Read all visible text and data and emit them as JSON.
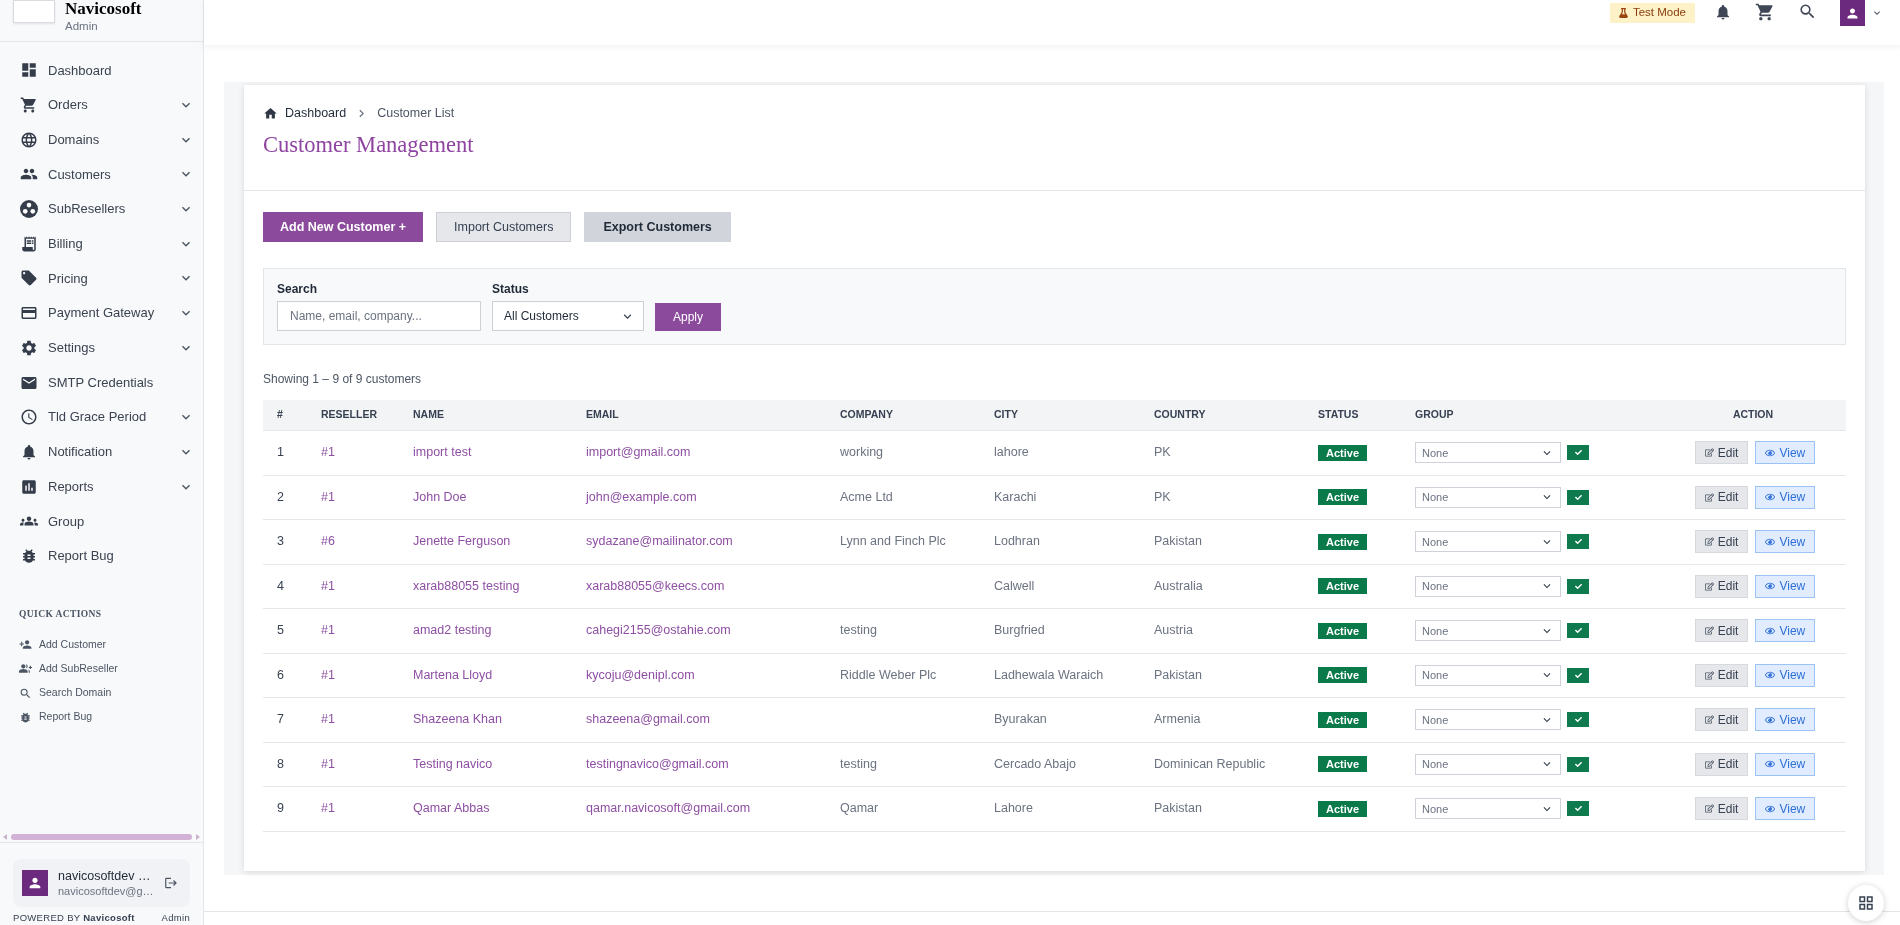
{
  "sidebar": {
    "brand": {
      "name": "Navicosoft",
      "role": "Admin"
    },
    "menu": [
      {
        "label": "Dashboard",
        "expandable": false
      },
      {
        "label": "Orders",
        "expandable": true
      },
      {
        "label": "Domains",
        "expandable": true
      },
      {
        "label": "Customers",
        "expandable": true
      },
      {
        "label": "SubResellers",
        "expandable": true
      },
      {
        "label": "Billing",
        "expandable": true
      },
      {
        "label": "Pricing",
        "expandable": true
      },
      {
        "label": "Payment Gateway",
        "expandable": true
      },
      {
        "label": "Settings",
        "expandable": true
      },
      {
        "label": "SMTP Credentials",
        "expandable": false
      },
      {
        "label": "Tld Grace Period",
        "expandable": true
      },
      {
        "label": "Notification",
        "expandable": true
      },
      {
        "label": "Reports",
        "expandable": true
      },
      {
        "label": "Group",
        "expandable": false
      },
      {
        "label": "Report Bug",
        "expandable": false
      }
    ],
    "quick_actions": {
      "title": "QUICK ACTIONS",
      "items": [
        {
          "label": "Add Customer"
        },
        {
          "label": "Add SubReseller"
        },
        {
          "label": "Search Domain"
        },
        {
          "label": "Report Bug"
        }
      ]
    },
    "user": {
      "name": "navicosoftdev …",
      "email": "navicosoftdev@g…"
    },
    "footer": {
      "powered_by": "POWERED BY **Navicosoft**",
      "role": "Admin"
    }
  },
  "top_bar": {
    "mode_badge": "Test Mode"
  },
  "breadcrumb": [
    {
      "label": "Dashboard"
    },
    {
      "label": "Customer List"
    }
  ],
  "page_title": "Customer Management",
  "actions": [
    {
      "label": "Add New Customer +",
      "kind": "primary"
    },
    {
      "label": "Import Customers",
      "kind": "light"
    },
    {
      "label": "Export Customers",
      "kind": "secondary"
    }
  ],
  "filters": {
    "search": {
      "label": "Search",
      "placeholder": "Name, email, company..."
    },
    "status": {
      "label": "Status",
      "value": "All Customers"
    },
    "apply": "Apply"
  },
  "summary": "Showing 1 – 9 of 9 customers",
  "table": {
    "columns": [
      "#",
      "RESELLER",
      "NAME",
      "EMAIL",
      "COMPANY",
      "CITY",
      "COUNTRY",
      "STATUS",
      "GROUP",
      "ACTION"
    ],
    "rows": [
      {
        "number": "1",
        "reseller": "#1",
        "name": "import test",
        "email": "import@gmail.com",
        "company": "working",
        "city": "lahore",
        "country": "PK",
        "status": "Active",
        "group": "None",
        "edit": "Edit",
        "view": "View"
      },
      {
        "number": "2",
        "reseller": "#1",
        "name": "John Doe",
        "email": "john@example.com",
        "company": "Acme Ltd",
        "city": "Karachi",
        "country": "PK",
        "status": "Active",
        "group": "None",
        "edit": "Edit",
        "view": "View"
      },
      {
        "number": "3",
        "reseller": "#6",
        "name": "Jenette Ferguson",
        "email": "sydazane@mailinator.com",
        "company": "Lynn and Finch Plc",
        "city": "Lodhran",
        "country": "Pakistan",
        "status": "Active",
        "group": "None",
        "edit": "Edit",
        "view": "View"
      },
      {
        "number": "4",
        "reseller": "#1",
        "name": "xarab88055 testing",
        "email": "xarab88055@keecs.com",
        "city": "Calwell",
        "country": "Australia",
        "status": "Active",
        "group": "None",
        "edit": "Edit",
        "view": "View"
      },
      {
        "number": "5",
        "reseller": "#1",
        "name": "amad2 testing",
        "email": "cahegi2155@ostahie.com",
        "company": "testing",
        "city": "Burgfried",
        "country": "Austria",
        "status": "Active",
        "group": "None",
        "edit": "Edit",
        "view": "View"
      },
      {
        "number": "6",
        "reseller": "#1",
        "name": "Martena Lloyd",
        "email": "kycoju@denipl.com",
        "company": "Riddle Weber Plc",
        "city": "Ladhewala Waraich",
        "country": "Pakistan",
        "status": "Active",
        "group": "None",
        "edit": "Edit",
        "view": "View"
      },
      {
        "number": "7",
        "reseller": "#1",
        "name": "Shazeena Khan",
        "email": "shazeena@gmail.com",
        "city": "Byurakan",
        "country": "Armenia",
        "status": "Active",
        "group": "None",
        "edit": "Edit",
        "view": "View"
      },
      {
        "number": "8",
        "reseller": "#1",
        "name": "Testing navico",
        "email": "testingnavico@gmail.com",
        "company": "testing",
        "city": "Cercado Abajo",
        "country": "Dominican Republic",
        "status": "Active",
        "group": "None",
        "edit": "Edit",
        "view": "View"
      },
      {
        "number": "9",
        "reseller": "#1",
        "name": "Qamar Abbas",
        "email": "qamar.navicosoft@gmail.com",
        "company": "Qamar",
        "city": "Lahore",
        "country": "Pakistan",
        "status": "Active",
        "group": "None",
        "edit": "Edit",
        "view": "View"
      }
    ]
  }
}
